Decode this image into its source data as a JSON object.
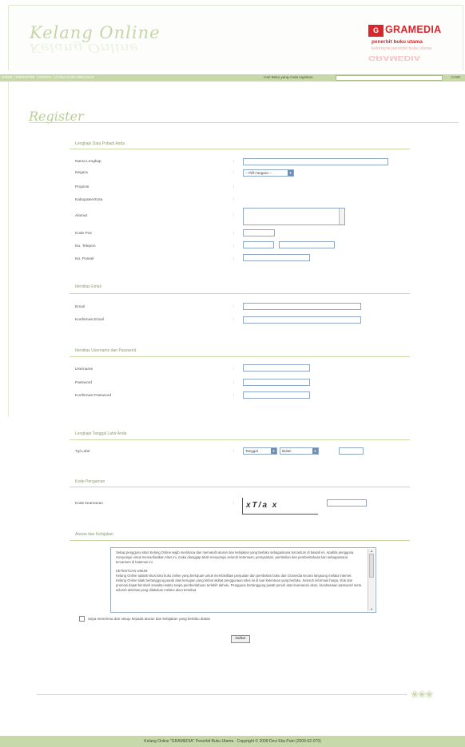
{
  "header": {
    "site_logo": "Kelang Online",
    "site_logo_reflection": "Kelang Online",
    "brand_box": "G",
    "brand_name": "GRAMEDIA",
    "brand_tagline": "penerbit buku utama",
    "brand_subtagline": "kelompok penerbit buku utama",
    "brand_reflection": "GRAMEDIA"
  },
  "nav": {
    "items": [
      "HOME",
      "REGISTER",
      "PROFIL",
      "CARA-CARA BELANJA"
    ],
    "search_label": "Cari Buku yang Anda inginkan",
    "search_value": "",
    "search_button": "CARI"
  },
  "page_title": "Register",
  "sections": {
    "personal": {
      "title": "Lengkapi Data Pribadi Anda",
      "fields": {
        "name": "Nama Lengkap",
        "country": "Negara",
        "province": "Propinsi",
        "city": "Kabupaten/Kota",
        "address": "Alamat",
        "postal": "Kode Pos",
        "phone": "No. Telepon",
        "mobile": "No. Ponsel"
      },
      "country_value": "-- Pilih Negara --"
    },
    "email": {
      "title": "Identitas Email",
      "fields": {
        "email": "Email",
        "email_confirm": "Konfirmasi Email"
      }
    },
    "account": {
      "title": "Identitas Username dan Password",
      "fields": {
        "username": "Username",
        "password": "Password",
        "password_confirm": "Konfirmasi Password"
      }
    },
    "birth": {
      "title": "Lengkapi Tanggal Lahir Anda",
      "label": "Tgl Lahir",
      "day_value": "Tanggal",
      "month_value": "Bulan"
    },
    "security": {
      "title": "Kode Pengaman",
      "label": "Kode keamanan",
      "captcha_text": "xT/a x"
    },
    "terms": {
      "title": "Aturan dan Kebijakan",
      "paragraph1": "Setiap pengguna situs Kelang Online wajib membaca dan mematuhi aturan dan kebijakan yang berlaku sebagaimana tercantum di bawah ini. Apabila pengguna menyetujui untuk memanfaatkan situs ini, maka dianggap telah menyetujui seluruh ketentuan, persyaratan, pembelian dan pemberitahuan lain sebagaimana tercantum di halaman ini.",
      "heading": "KETENTUAN UMUM",
      "paragraph2": "Kelang Online adalah situs toko buku online yang bertujuan untuk memfasilitasi penjualan dan pembelian buku dari Gramedia secara langsung melalui internet. Kelang Online tidak bertanggung jawab atas kerugian yang timbul akibat penggunaan situs ini di luar ketentuan yang berlaku. Seluruh informasi harga, stok dan promosi dapat berubah sewaktu-waktu tanpa pemberitahuan terlebih dahulu. Pengguna bertanggung jawab penuh atas keamanan akun, kerahasiaan password serta seluruh aktivitas yang dilakukan melalui akun tersebut."
    },
    "agree_label": "Saya menerima dan setuju kepada aturan dan kebijakan yang berlaku diatas",
    "submit_label": "Daftar"
  },
  "footer": {
    "text": "Kelang Online \"GRAMEDIA\" Penerbit Buku Utama · Copyright © 2008 Devi Eka Putri (2009-02-079)"
  }
}
